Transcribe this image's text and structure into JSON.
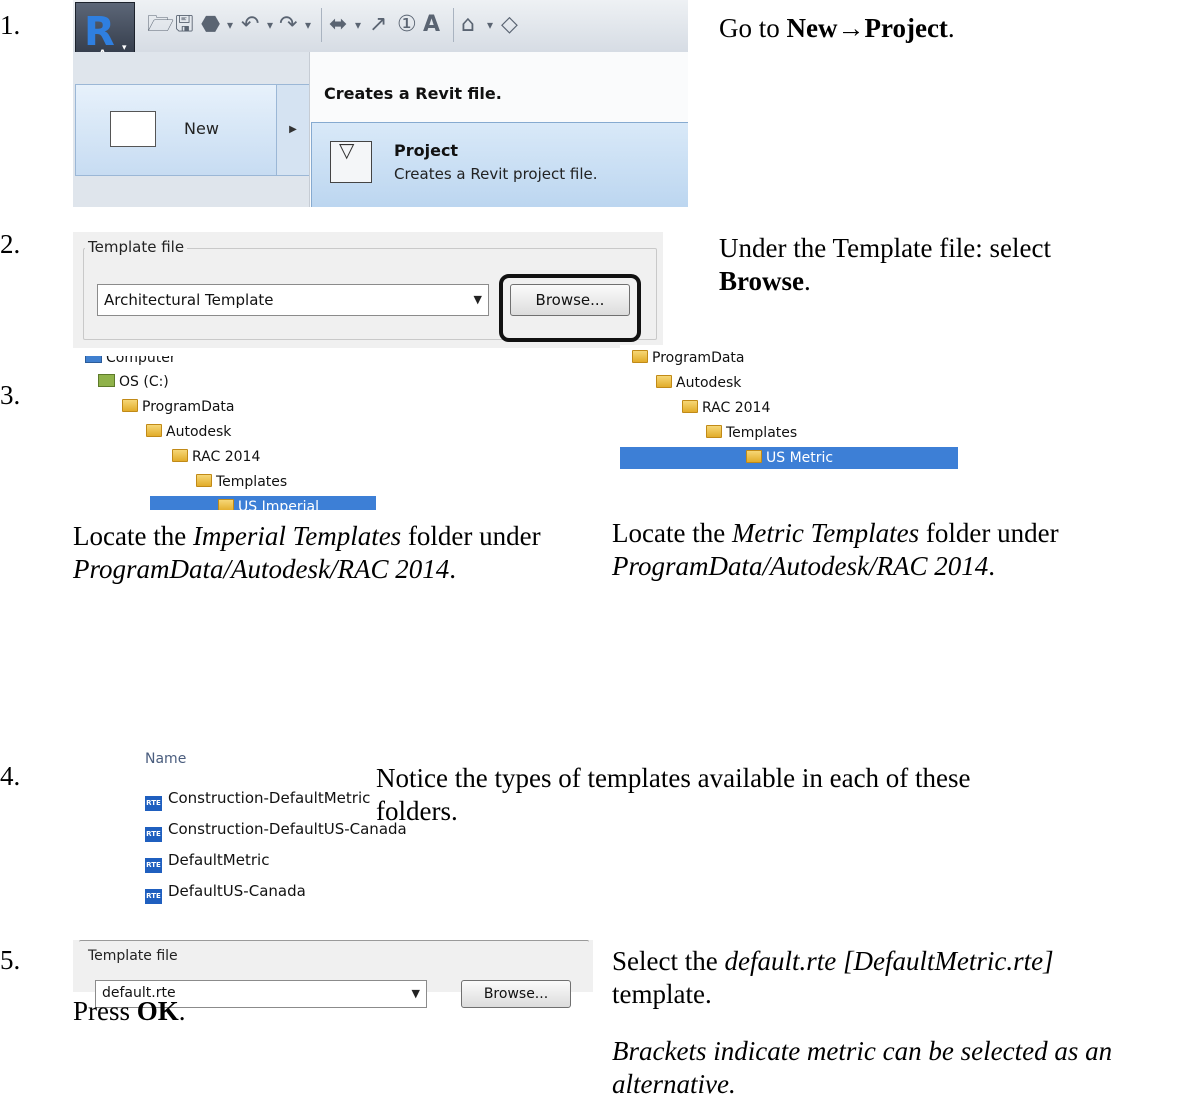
{
  "steps": {
    "s1": {
      "num": "1.",
      "instruction_pre": "Go to ",
      "instruction_bold": "New→Project",
      "instruction_post": ".",
      "ui": {
        "app_letter": "R",
        "app_sub": "A",
        "new_label": "New",
        "menu_header": "Creates a Revit file.",
        "project_title": "Project",
        "project_desc": "Creates a Revit project file."
      }
    },
    "s2": {
      "num": "2.",
      "instruction_pre": "Under the Template file:  select",
      "instruction_bold": "Browse",
      "instruction_post": ".",
      "ui": {
        "group_label": "Template file",
        "combo_value": "Architectural Template",
        "browse_label": "Browse..."
      }
    },
    "s3": {
      "num": "3.",
      "tree_imperial": [
        "Computer",
        "OS (C:)",
        "ProgramData",
        "Autodesk",
        "RAC 2014",
        "Templates",
        "US Imperial"
      ],
      "tree_metric": [
        "ProgramData",
        "Autodesk",
        "RAC 2014",
        "Templates",
        "US Metric"
      ],
      "caption_imperial": {
        "pre": "Locate the ",
        "ital": "Imperial Templates",
        "mid": " folder under ",
        "path": "ProgramData/Autodesk/RAC 2014",
        "post": "."
      },
      "caption_metric": {
        "pre": "Locate the ",
        "ital": "Metric Templates",
        "mid": " folder under ",
        "path": "ProgramData/Autodesk/RAC 2014",
        "post": "."
      }
    },
    "s4": {
      "num": "4.",
      "header": "Name",
      "files": [
        "Construction-DefaultMetric",
        "Construction-DefaultUS-Canada",
        "DefaultMetric",
        "DefaultUS-Canada"
      ],
      "file_icon": "RTE",
      "instruction": "Notice the types of templates available in each of these folders."
    },
    "s5": {
      "num": "5.",
      "ui": {
        "group_label": "Template file",
        "combo_value": "default.rte",
        "browse_label": "Browse..."
      },
      "press_pre": "Press ",
      "press_bold": "OK",
      "press_post": ".",
      "select_pre": "Select the ",
      "select_ital": "default.rte [DefaultMetric.rte]",
      "select_post": "template.",
      "note": "Brackets indicate metric can be selected as an alternative."
    }
  },
  "colors": {
    "selection": "#3d7fd6",
    "highlight_box": "#111111"
  }
}
